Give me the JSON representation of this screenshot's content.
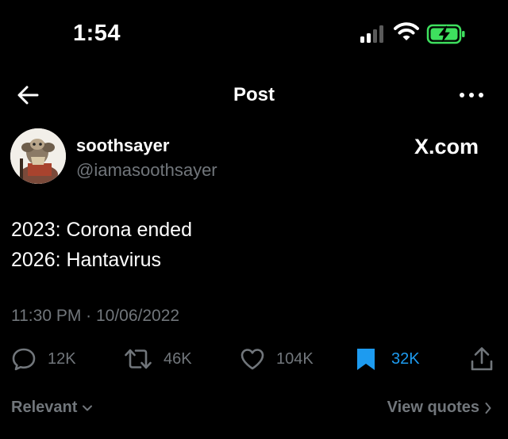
{
  "status_bar": {
    "time": "1:54"
  },
  "nav": {
    "title": "Post"
  },
  "author": {
    "display_name": "soothsayer",
    "handle": "@iamasoothsayer",
    "watermark": "X.com"
  },
  "post": {
    "lines": [
      "2023: Corona ended",
      "2026: Hantavirus"
    ],
    "meta": "11:30 PM · 10/06/2022"
  },
  "actions": {
    "replies": "12K",
    "reposts": "46K",
    "likes": "104K",
    "bookmarks": "32K"
  },
  "footer": {
    "relevant_label": "Relevant",
    "view_quotes_label": "View quotes"
  },
  "colors": {
    "background": "#000000",
    "text": "#ffffff",
    "muted": "#71767b",
    "accent": "#1d9bf0",
    "battery_charge": "#3ee05e"
  },
  "icons": [
    "signal-icon",
    "wifi-icon",
    "battery-charging-icon",
    "back-arrow-icon",
    "more-icon",
    "reply-icon",
    "repost-icon",
    "like-icon",
    "bookmark-icon",
    "share-icon",
    "chevron-down-icon",
    "chevron-right-icon"
  ]
}
